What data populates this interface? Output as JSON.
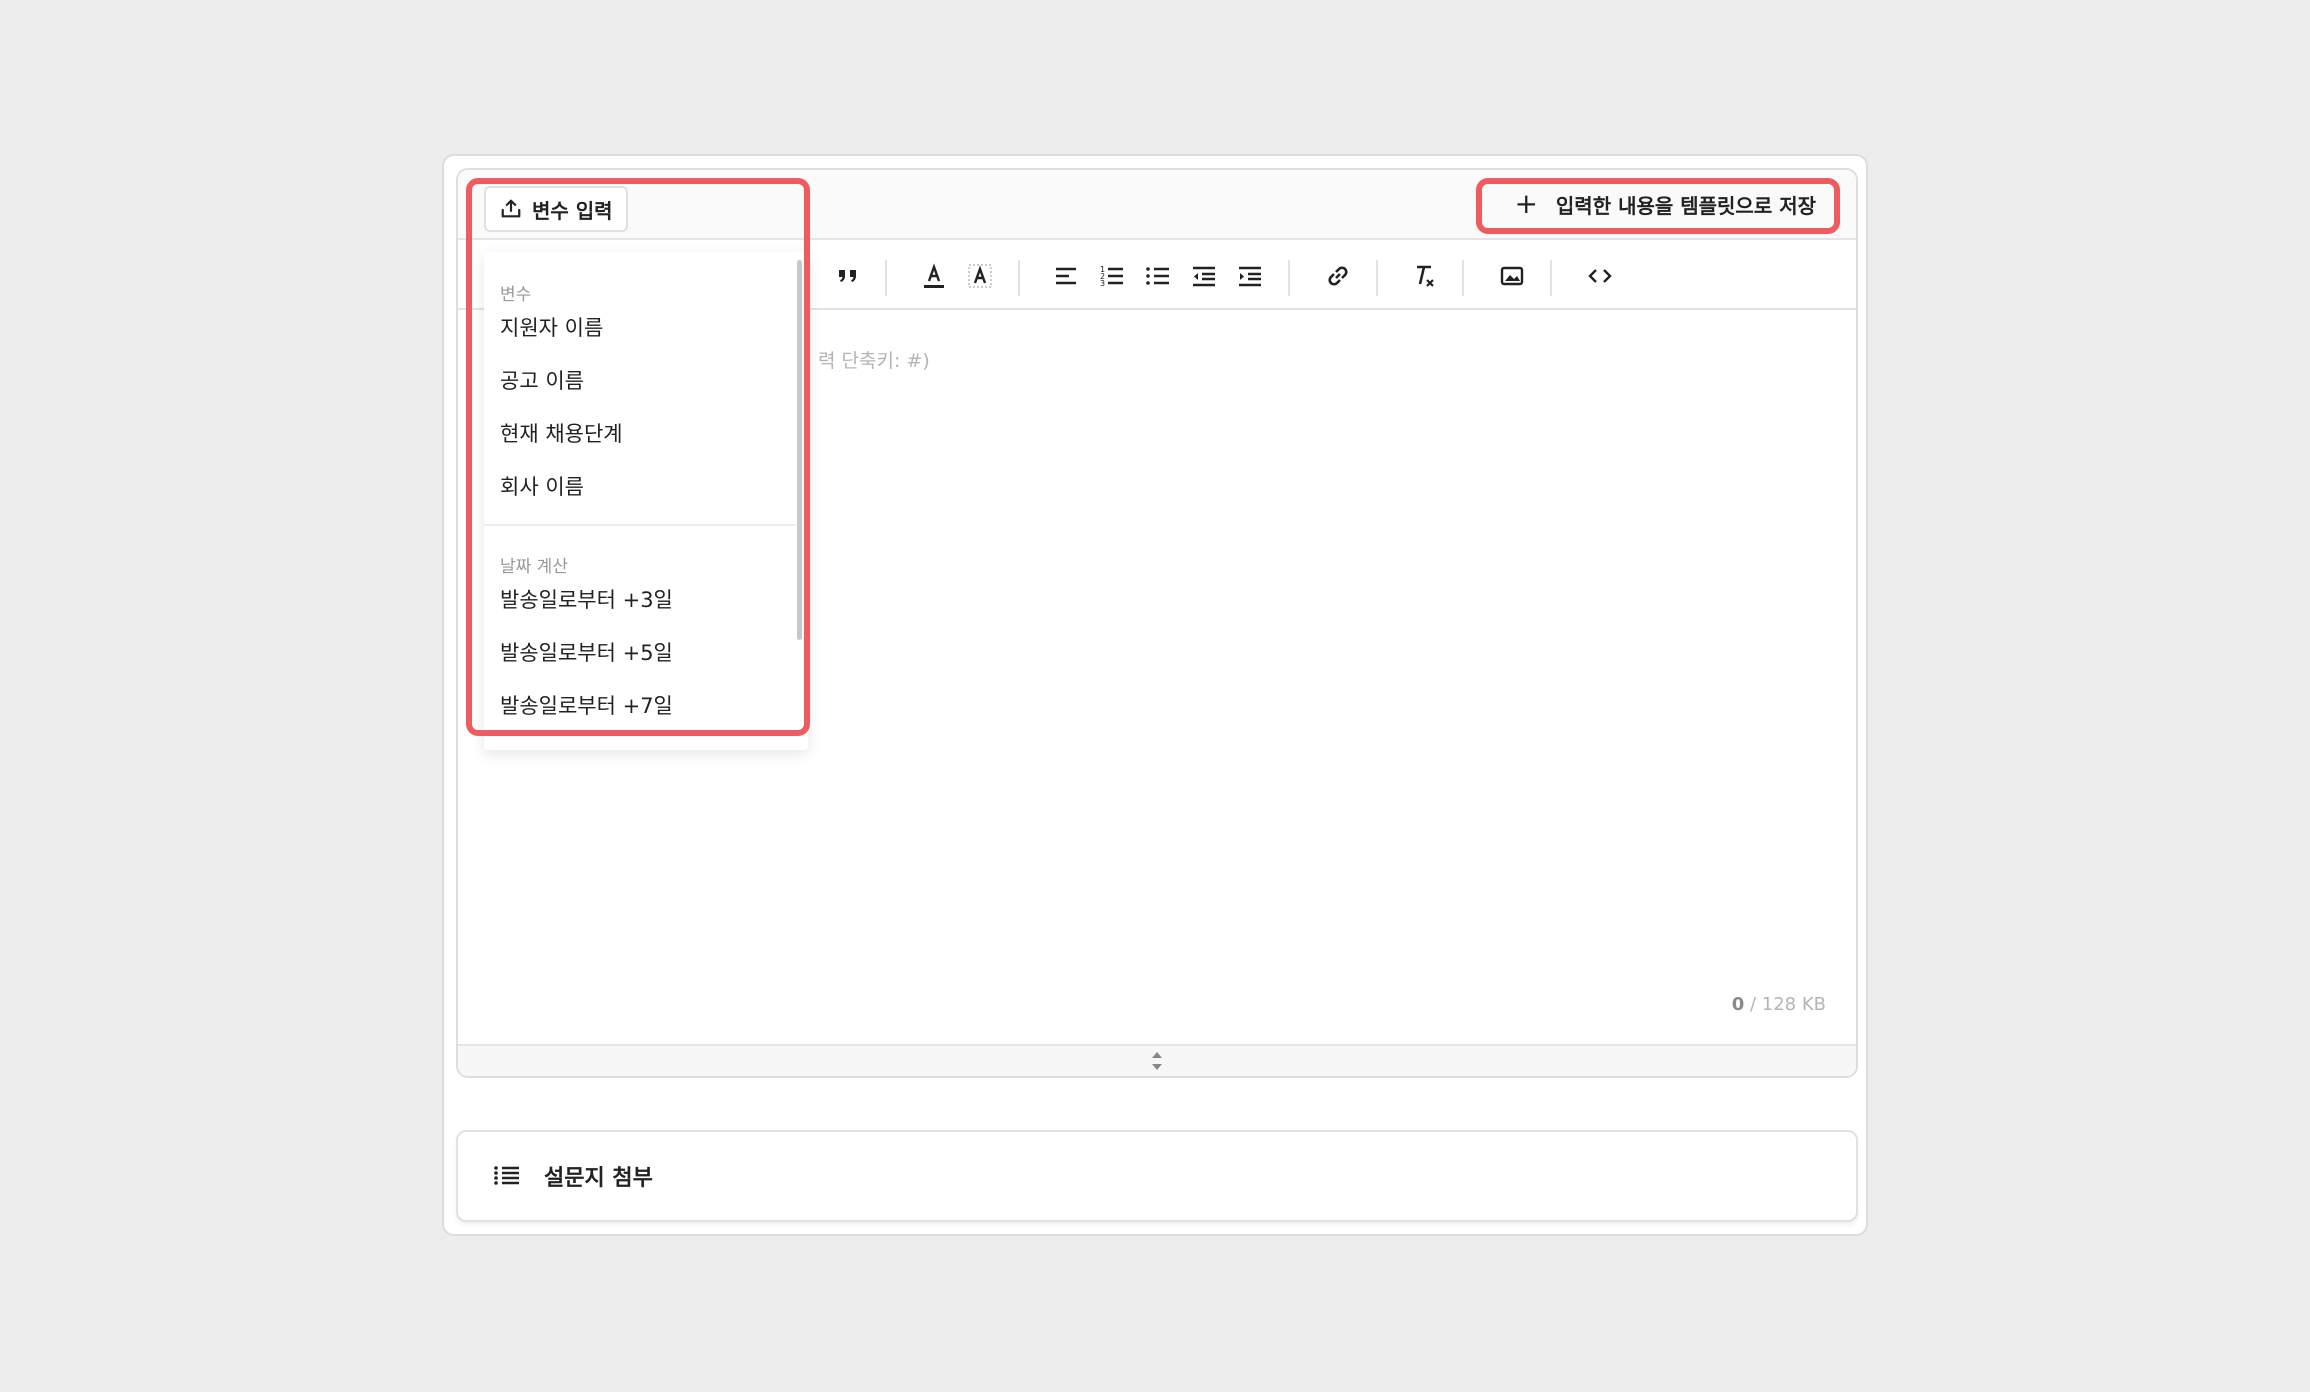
{
  "header": {
    "variable_button_label": "변수 입력",
    "save_template_label": "입력한 내용을 템플릿으로 저장"
  },
  "toolbar": {
    "icons": [
      "quote-icon",
      "font-color-icon",
      "highlight-color-icon",
      "align-left-icon",
      "ordered-list-icon",
      "bullet-list-icon",
      "outdent-icon",
      "indent-icon",
      "link-icon",
      "clear-format-icon",
      "image-icon",
      "code-icon"
    ]
  },
  "editor": {
    "placeholder_visible": "력 단축키: #)",
    "size_used": "0",
    "size_limit": " / 128 KB"
  },
  "dropdown": {
    "groups": [
      {
        "title": "변수",
        "items": [
          "지원자 이름",
          "공고 이름",
          "현재 채용단계",
          "회사 이름"
        ]
      },
      {
        "title": "날짜 계산",
        "items": [
          "발송일로부터 +3일",
          "발송일로부터 +5일",
          "발송일로부터 +7일"
        ]
      }
    ]
  },
  "survey": {
    "label": "설문지 첨부"
  },
  "colors": {
    "highlight": "#ef5b5f",
    "background": "#ededed",
    "text": "#222222",
    "muted": "#b4b4b4"
  }
}
